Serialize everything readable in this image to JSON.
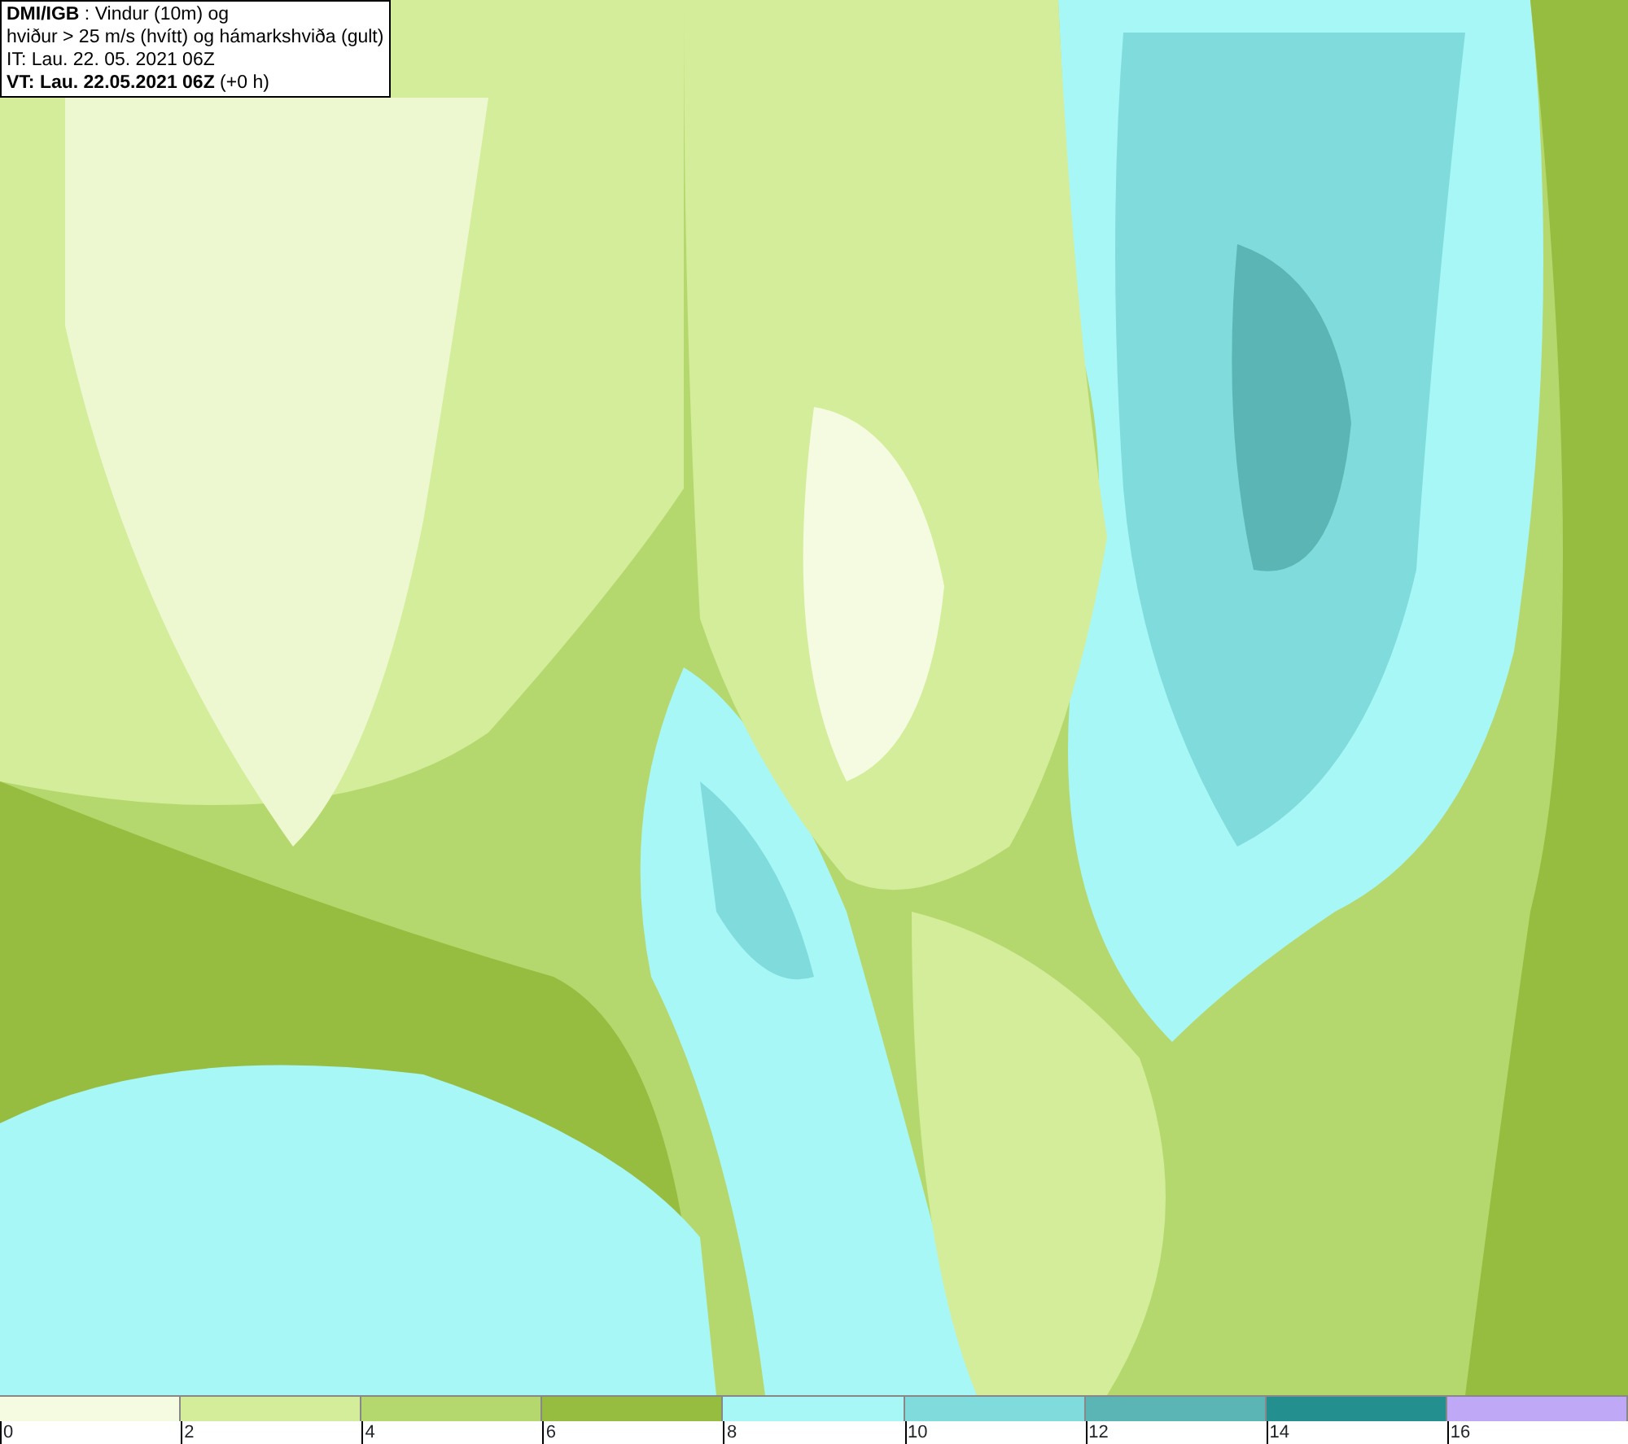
{
  "info_box": {
    "lines": [
      "**DMI/IGB** : Vindur (10m) og",
      "hviður > 25 m/s (hvítt) og hámarkshviða (gult)",
      "IT: Lau. 22. 05. 2021 06Z",
      "**VT: Lau. 22.05.2021 06Z** (+0 h)"
    ]
  },
  "legend": {
    "items": [
      {
        "color": "#f5fbe0",
        "label": "0"
      },
      {
        "color": "#d4ed9a",
        "label": "2"
      },
      {
        "color": "#b5d86e",
        "label": "4"
      },
      {
        "color": "#97bd40",
        "label": "6"
      },
      {
        "color": "#a8f7f7",
        "label": "8"
      },
      {
        "color": "#80dcdc",
        "label": "10"
      },
      {
        "color": "#5bb5b5",
        "label": "12"
      },
      {
        "color": "#248f8f",
        "label": "14"
      },
      {
        "color": "#bfa8f5",
        "label": "16"
      }
    ]
  }
}
